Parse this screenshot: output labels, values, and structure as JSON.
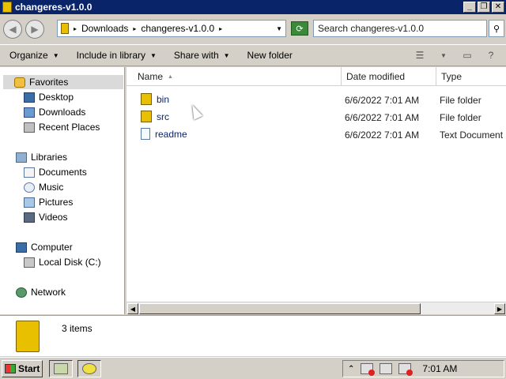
{
  "window": {
    "title": "changeres-v1.0.0",
    "controls": {
      "minimize": "_",
      "restore": "❐",
      "close": "✕"
    }
  },
  "address": {
    "segments": [
      "Downloads",
      "changeres-v1.0.0"
    ],
    "search_placeholder": "Search changeres-v1.0.0"
  },
  "toolbar": {
    "organize": "Organize",
    "include_in_library": "Include in library",
    "share_with": "Share with",
    "new_folder": "New folder"
  },
  "navigation": {
    "favorites": {
      "label": "Favorites",
      "items": [
        "Desktop",
        "Downloads",
        "Recent Places"
      ]
    },
    "libraries": {
      "label": "Libraries",
      "items": [
        "Documents",
        "Music",
        "Pictures",
        "Videos"
      ]
    },
    "computer": {
      "label": "Computer",
      "items": [
        "Local Disk (C:)"
      ]
    },
    "network": {
      "label": "Network"
    }
  },
  "columns": {
    "name": "Name",
    "date_modified": "Date modified",
    "type": "Type"
  },
  "files": [
    {
      "name": "bin",
      "date": "6/6/2022 7:01 AM",
      "type": "File folder",
      "icon": "folder-icon"
    },
    {
      "name": "src",
      "date": "6/6/2022 7:01 AM",
      "type": "File folder",
      "icon": "folder-icon"
    },
    {
      "name": "readme",
      "date": "6/6/2022 7:01 AM",
      "type": "Text Document",
      "icon": "text-document-icon"
    }
  ],
  "details": {
    "item_count": "3 items"
  },
  "taskbar": {
    "start": "Start",
    "clock": "7:01 AM"
  },
  "colors": {
    "title_bar": "#0a246a",
    "chrome": "#d4d0c8",
    "link_text": "#0a246a",
    "folder": "#e8c000"
  }
}
